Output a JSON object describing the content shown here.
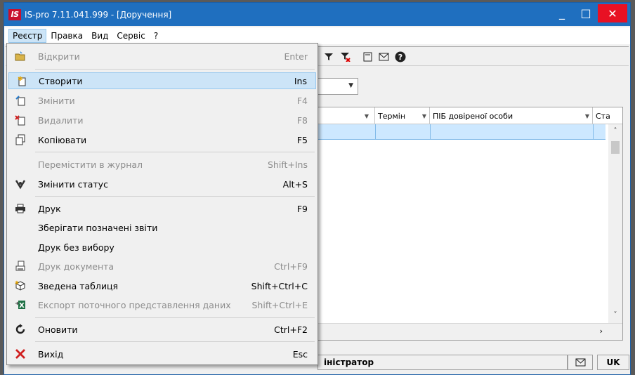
{
  "window": {
    "title": "IS-pro 7.11.041.999 - [Доручення]",
    "app_icon_text": "IS",
    "min": "_",
    "max": "□",
    "close": "✕"
  },
  "menubar": [
    "Реєстр",
    "Правка",
    "Вид",
    "Сервіс",
    "?"
  ],
  "grid": {
    "columns": [
      "Термін",
      "ПІБ довіреної особи",
      "Ста"
    ]
  },
  "statusbar": {
    "user": "іністратор",
    "lang": "UK"
  },
  "dropdown": {
    "items": [
      {
        "label": "Відкрити",
        "shortcut": "Enter",
        "disabled": true,
        "icon": "open-icon"
      },
      {
        "label": "Створити",
        "shortcut": "Ins",
        "disabled": false,
        "icon": "create-icon"
      },
      {
        "label": "Змінити",
        "shortcut": "F4",
        "disabled": true,
        "icon": "edit-icon"
      },
      {
        "label": "Видалити",
        "shortcut": "F8",
        "disabled": true,
        "icon": "delete-icon"
      },
      {
        "label": "Копіювати",
        "shortcut": "F5",
        "disabled": false,
        "icon": "copy-icon"
      },
      {
        "label": "Перемістити в журнал",
        "shortcut": "Shift+Ins",
        "disabled": true,
        "icon": ""
      },
      {
        "label": "Змінити статус",
        "shortcut": "Alt+S",
        "disabled": false,
        "icon": "status-icon"
      },
      {
        "label": "Друк",
        "shortcut": "F9",
        "disabled": false,
        "icon": "print-icon"
      },
      {
        "label": "Зберігати позначені звіти",
        "shortcut": "",
        "disabled": false,
        "icon": ""
      },
      {
        "label": "Друк без вибору",
        "shortcut": "",
        "disabled": false,
        "icon": ""
      },
      {
        "label": "Друк документа",
        "shortcut": "Ctrl+F9",
        "disabled": true,
        "icon": "print-document-icon"
      },
      {
        "label": "Зведена таблиця",
        "shortcut": "Shift+Ctrl+C",
        "disabled": false,
        "icon": "pivot-table-icon"
      },
      {
        "label": "Експорт поточного представлення даних",
        "shortcut": "Shift+Ctrl+E",
        "disabled": true,
        "icon": "excel-export-icon"
      },
      {
        "label": "Оновити",
        "shortcut": "Ctrl+F2",
        "disabled": false,
        "icon": "refresh-icon"
      },
      {
        "label": "Вихід",
        "shortcut": "Esc",
        "disabled": false,
        "icon": "exit-icon"
      }
    ]
  },
  "colors": {
    "titlebar": "#1f6fbf",
    "close": "#e81123",
    "highlight": "#cce4f7"
  }
}
